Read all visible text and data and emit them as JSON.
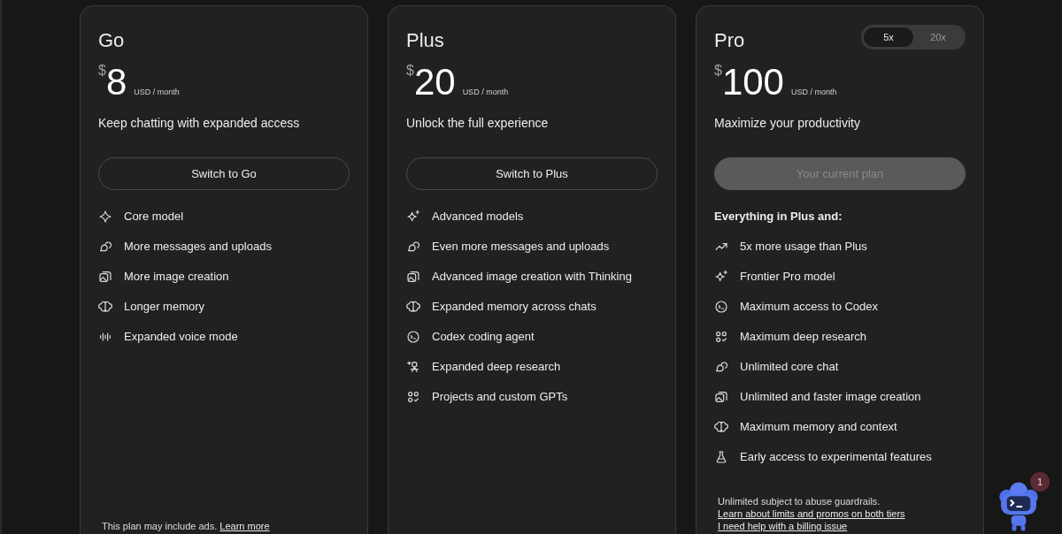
{
  "plans": [
    {
      "name": "Go",
      "currency": "$",
      "price": "8",
      "period": "USD / month",
      "tagline": "Keep chatting with expanded access",
      "button": {
        "label": "Switch to Go",
        "disabled": false
      },
      "features": [
        {
          "kind": "sparkle",
          "text": "Core model"
        },
        {
          "kind": "chat",
          "text": "More messages and uploads"
        },
        {
          "kind": "image",
          "text": "More image creation"
        },
        {
          "kind": "brain",
          "text": "Longer memory"
        },
        {
          "kind": "voice",
          "text": "Expanded voice mode"
        }
      ],
      "footer": [
        {
          "text": "This plan may include ads. ",
          "link": "Learn more"
        }
      ]
    },
    {
      "name": "Plus",
      "currency": "$",
      "price": "20",
      "period": "USD / month",
      "tagline": "Unlock the full experience",
      "button": {
        "label": "Switch to Plus",
        "disabled": false
      },
      "features": [
        {
          "kind": "sparkles",
          "text": "Advanced models"
        },
        {
          "kind": "chat",
          "text": "Even more messages and uploads"
        },
        {
          "kind": "image",
          "text": "Advanced image creation with Thinking"
        },
        {
          "kind": "brain",
          "text": "Expanded memory across chats"
        },
        {
          "kind": "terminal",
          "text": "Codex coding agent"
        },
        {
          "kind": "research",
          "text": "Expanded deep research"
        },
        {
          "kind": "grid",
          "text": "Projects and custom GPTs"
        }
      ]
    },
    {
      "name": "Pro",
      "tiers": [
        {
          "label": "5x",
          "selected": true
        },
        {
          "label": "20x",
          "selected": false
        }
      ],
      "currency": "$",
      "price": "100",
      "period": "USD / month",
      "tagline": "Maximize your productivity",
      "button": {
        "label": "Your current plan",
        "disabled": true
      },
      "features_heading": "Everything in Plus and:",
      "features": [
        {
          "kind": "trend",
          "text": "5x more usage than Plus"
        },
        {
          "kind": "sparkles",
          "text": "Frontier Pro model"
        },
        {
          "kind": "terminal",
          "text": "Maximum access to Codex"
        },
        {
          "kind": "grid",
          "text": "Maximum deep research"
        },
        {
          "kind": "chat",
          "text": "Unlimited core chat"
        },
        {
          "kind": "image",
          "text": "Unlimited and faster image creation"
        },
        {
          "kind": "brain",
          "text": "Maximum memory and context"
        },
        {
          "kind": "flask",
          "text": "Early access to experimental features"
        }
      ],
      "footer": [
        {
          "text": "Unlimited subject to abuse guardrails."
        },
        {
          "link": "Learn about limits and promos on both tiers"
        },
        {
          "link": "I need help with a billing issue"
        }
      ]
    }
  ],
  "assistant": {
    "badge": "1"
  }
}
